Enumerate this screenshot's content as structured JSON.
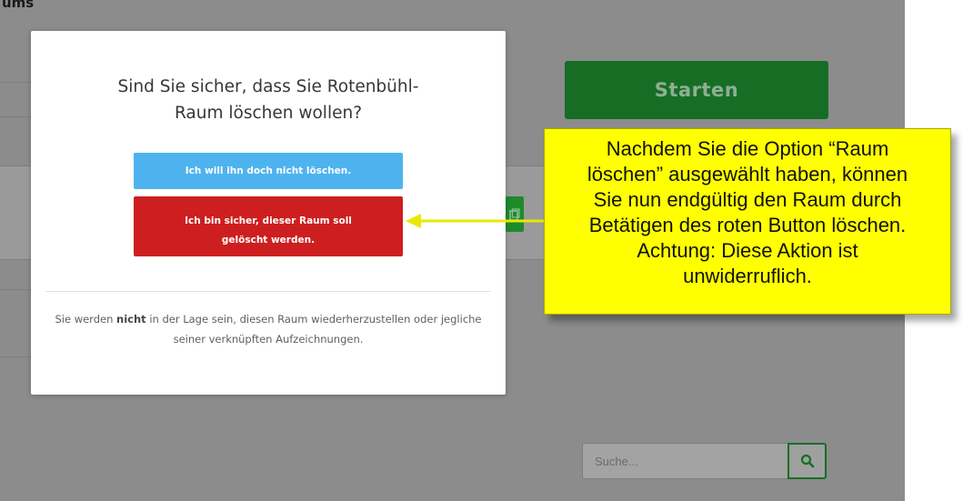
{
  "background": {
    "heading_fragment": "ums",
    "start_button_label": "Starten",
    "search": {
      "placeholder": "Suche..."
    }
  },
  "modal": {
    "title_line1": "Sind Sie sicher, dass Sie Rotenbühl-",
    "title_line2": "Raum löschen wollen?",
    "cancel_label": "Ich will ihn doch nicht löschen.",
    "delete_label": "Ich bin sicher, dieser Raum soll gelöscht werden.",
    "note_before": "Sie werden ",
    "note_bold": "nicht",
    "note_after": " in der Lage sein, diesen Raum wiederherzustellen oder jegliche seiner verknüpften Aufzeichnungen."
  },
  "callout": {
    "lines": [
      "Nachdem Sie die Option “Raum",
      "löschen” ausgewählt haben, können",
      "Sie nun endgültig den Raum durch",
      "Betätigen des roten Button löschen.",
      "Achtung:  Diese Aktion ist",
      "unwiderruflich."
    ]
  },
  "colors": {
    "overlay_gray": "#8c8c8c",
    "start_green": "#166e25",
    "cancel_blue": "#4db3ef",
    "delete_red": "#cd1f1f",
    "callout_yellow": "#ffff00"
  },
  "icons": [
    "copy-icon",
    "search-icon",
    "arrow-icon"
  ]
}
